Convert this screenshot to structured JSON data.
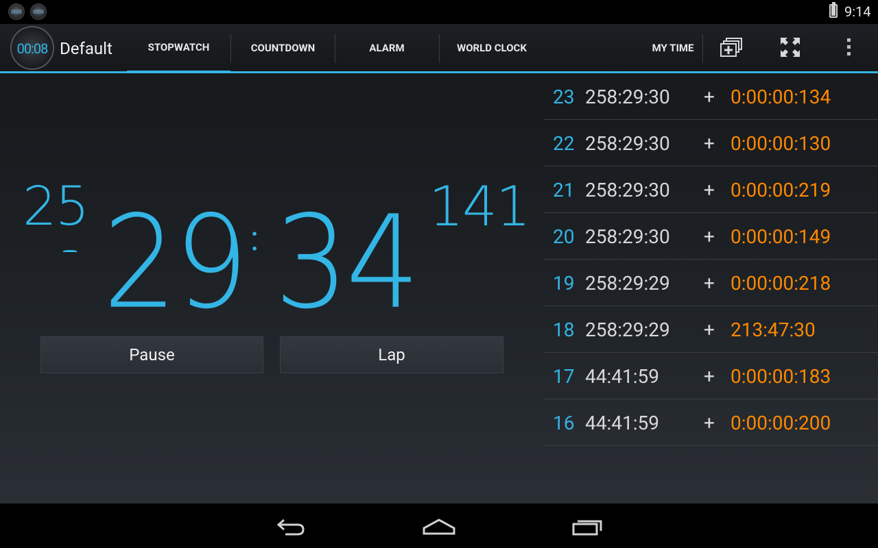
{
  "status_bar": {
    "time": "9:14",
    "notification_icons": [
      "stopwatch-notification-icon",
      "stopwatch-notification-icon"
    ],
    "battery": "battery-icon"
  },
  "action_bar": {
    "app_icon_time": "00:08",
    "profile_title": "Default",
    "tabs": [
      {
        "label": "STOPWATCH",
        "selected": true
      },
      {
        "label": "COUNTDOWN",
        "selected": false
      },
      {
        "label": "ALARM",
        "selected": false
      },
      {
        "label": "WORLD CLOCK",
        "selected": false
      }
    ],
    "my_time_label": "MY TIME",
    "actions": [
      "add-window-icon",
      "fullscreen-icon",
      "overflow-menu-icon"
    ],
    "accent_color": "#33b5e5"
  },
  "stopwatch": {
    "hours": "25",
    "minutes": "29",
    "separator": ":",
    "seconds": "34",
    "milliseconds": "141",
    "pause_label": "Pause",
    "lap_label": "Lap"
  },
  "laps": [
    {
      "number": "23",
      "total": "258:29:30",
      "plus": "+",
      "split": "0:00:00:134"
    },
    {
      "number": "22",
      "total": "258:29:30",
      "plus": "+",
      "split": "0:00:00:130"
    },
    {
      "number": "21",
      "total": "258:29:30",
      "plus": "+",
      "split": "0:00:00:219"
    },
    {
      "number": "20",
      "total": "258:29:30",
      "plus": "+",
      "split": "0:00:00:149"
    },
    {
      "number": "19",
      "total": "258:29:29",
      "plus": "+",
      "split": "0:00:00:218"
    },
    {
      "number": "18",
      "total": "258:29:29",
      "plus": "+",
      "split": "213:47:30"
    },
    {
      "number": "17",
      "total": "44:41:59",
      "plus": "+",
      "split": "0:00:00:183"
    },
    {
      "number": "16",
      "total": "44:41:59",
      "plus": "+",
      "split": "0:00:00:200"
    }
  ],
  "nav_bar": {
    "buttons": [
      "back-icon",
      "home-icon",
      "recent-apps-icon"
    ]
  },
  "colors": {
    "accent": "#33b5e5",
    "split_orange": "#ff8800"
  }
}
